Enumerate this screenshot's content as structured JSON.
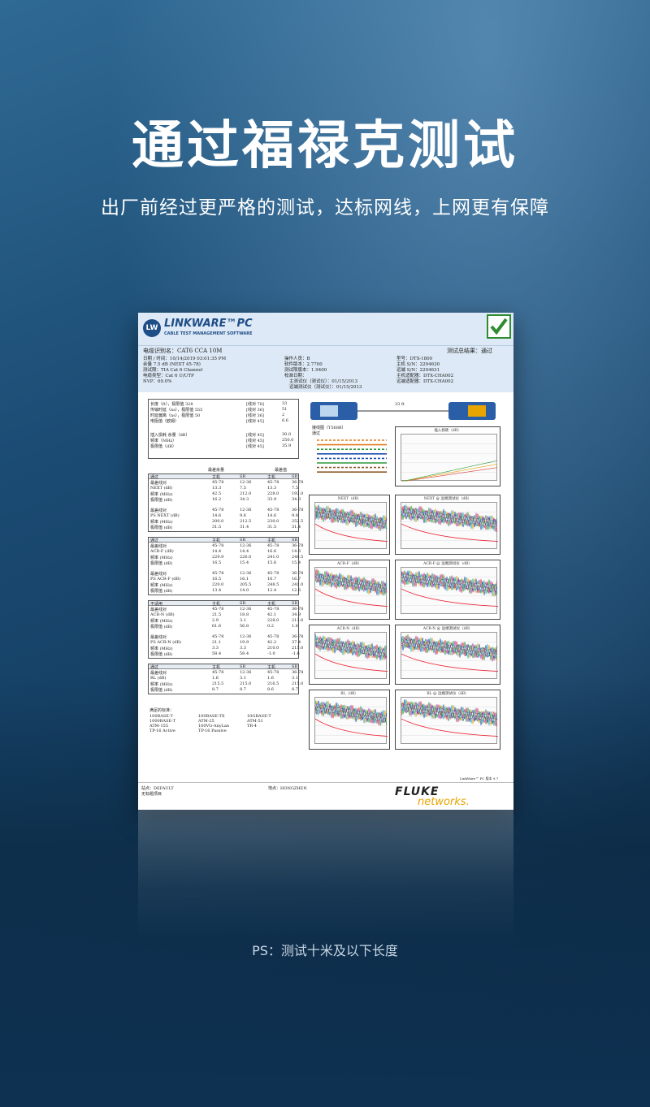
{
  "hero": {
    "title": "通过福禄克测试",
    "subtitle": "出厂前经过更严格的测试，达标网线，上网更有保障",
    "note": "PS：测试十米及以下长度"
  },
  "report": {
    "app_name": "LINKWARE™PC",
    "app_tagline": "CABLE TEST MANAGEMENT SOFTWARE",
    "logo_text": "LW",
    "cable_id": "电缆识别名：CAT6  CCA 10M",
    "date_time": "日期 / 时间：10/14/2019  03:01:35 PM",
    "headroom": "余量 7.5 dB (NEXT 45-78)",
    "test_limit": "测试限：TIA Cat 6 Channel",
    "cable_type": "电缆类型：Cat 6 U/UTP",
    "nvp": "NVP：69.0%",
    "operator": "操作人员：B",
    "software_version": "软件版本：2.7700",
    "limit_version": "测试限版本：1.9400",
    "calibration_date": "校准日期：",
    "main_calibration": "主测试仪（测试仪）：01/15/2013",
    "remote_calibration": "远端测试仪（测试仪）：01/15/2013",
    "model": "型号：DTX-1800",
    "main_sn": "主机 S/N：2294630",
    "remote_sn": "远端 S/N：2294631",
    "main_adapter": "主机适配器：DTX-CHA002",
    "remote_adapter": "远端适配器：DTX-CHA002",
    "summary_result": "测试总结果：通过",
    "length_rows": [
      {
        "label": "长度（ft），极限值 328",
        "pair": "[线对 78]",
        "value": "33"
      },
      {
        "label": "传输时延（ns），极限值 555",
        "pair": "[线对 36]",
        "value": "51"
      },
      {
        "label": "时延偏离（ns），极限值 50",
        "pair": "[线对 36]",
        "value": "2"
      },
      {
        "label": "电阻值（欧姆）",
        "pair": "[线对 45]",
        "value": "6.6"
      },
      {
        "label": "插入损耗 余量（dB）",
        "pair": "[线对 45]",
        "value": "30.0"
      },
      {
        "label": "频率（MHz）",
        "pair": "[线对 45]",
        "value": "250.0"
      },
      {
        "label": "极限值（dB）",
        "pair": "[线对 45]",
        "value": "35.9"
      }
    ],
    "worst_margin": "最差余量",
    "worst_value": "最差值",
    "col_main": "主机",
    "col_sr": "SR",
    "status_pass": "通过",
    "status_na": "不适用",
    "pair_labels": [
      "45-78",
      "12-36",
      "36-78"
    ],
    "next_rows": [
      "最差线对",
      "NEXT (dB)",
      "频率 (MHz)",
      "极限值 (dB)"
    ],
    "next_vals": [
      [
        "13.3",
        "7.5",
        "13.3",
        "7.5"
      ],
      [
        "42.5",
        "212.0",
        "228.0",
        "192.0"
      ],
      [
        "16.2",
        "34.3",
        "33.9",
        "34.3"
      ]
    ],
    "psnext_label": "PS NEXT (dB)",
    "psnext_vals": [
      [
        "14.6",
        "9.6",
        "14.6",
        "9.8"
      ],
      [
        "200.0",
        "212.5",
        "230.0",
        "252.5"
      ],
      [
        "31.5",
        "31.4",
        "31.5",
        "31.4"
      ]
    ],
    "acrf_label": "ACR-F (dB)",
    "acrf_vals": [
      [
        "14.4",
        "14.4",
        "16.6",
        "14.6"
      ],
      [
        "229.9",
        "226.0",
        "241.0",
        "248.5"
      ],
      [
        "16.5",
        "15.4",
        "15.6",
        "15.4"
      ]
    ],
    "psacrf_label": "PS ACR-F (dB)",
    "psacrf_vals": [
      [
        "16.5",
        "16.1",
        "16.7",
        "16.7"
      ],
      [
        "220.0",
        "205.5",
        "248.5",
        "241.0"
      ],
      [
        "13.4",
        "14.0",
        "12.4",
        "12.6"
      ]
    ],
    "acrn_label": "ACR-N (dB)",
    "acrn_vals": [
      [
        "21.5",
        "18.8",
        "42.1",
        "34.9"
      ],
      [
        "2.9",
        "3.1",
        "228.0",
        "213.0"
      ],
      [
        "61.6",
        "56.8",
        "0.2",
        "1.6"
      ]
    ],
    "psacrn_label": "PS ACR-N (dB)",
    "psacrn_vals": [
      [
        "21.1",
        "19.9",
        "42.2",
        "37.4"
      ],
      [
        "3.3",
        "3.3",
        "210.0",
        "215.0"
      ],
      [
        "58.4",
        "58.4",
        "-1.0",
        "-1.6"
      ]
    ],
    "rl_label": "RL (dB)",
    "rl_vals": [
      [
        "1.6",
        "3.1",
        "1.6",
        "3.1"
      ],
      [
        "215.5",
        "215.0",
        "216.5",
        "215.0"
      ],
      [
        "8.7",
        "8.7",
        "8.6",
        "8.7"
      ]
    ],
    "compliant_label": "满足的标准：",
    "compliant_list": [
      "100BASE-T",
      "1000BASE-T",
      "ATM-155",
      "TP-16 Active",
      "100BASE-TX",
      "ATM-25",
      "100VG-AnyLan",
      "TP-16 Passive",
      "10GBASE-T",
      "ATM-51",
      "TR-4"
    ],
    "wiremap_title": "接线图（T568B）",
    "wiremap_result": "通过",
    "wiremap_length": "33 ft",
    "plot_titles": [
      "插入损耗（dB）",
      "NEXT（dB）",
      "NEXT @ 远端测试仪（dB）",
      "ACR-F（dB）",
      "ACR-F @ 远端测试仪（dB）",
      "ACR-N（dB）",
      "ACR-N @ 远端测试仪（dB）",
      "RL（dB）",
      "RL @ 远端测试仪（dB）"
    ],
    "site": "站点：DEFAULT",
    "no_project": "无标题项目",
    "location": "地点：HONGZHEN",
    "software_footer": "LinkWare™ PC 版本 9.7",
    "fluke": "FLUKE",
    "networks": "networks."
  },
  "colors": {
    "accent": "#1f4d86",
    "pass_green": "#2e8c2e",
    "networks_yellow": "#e8a400"
  }
}
